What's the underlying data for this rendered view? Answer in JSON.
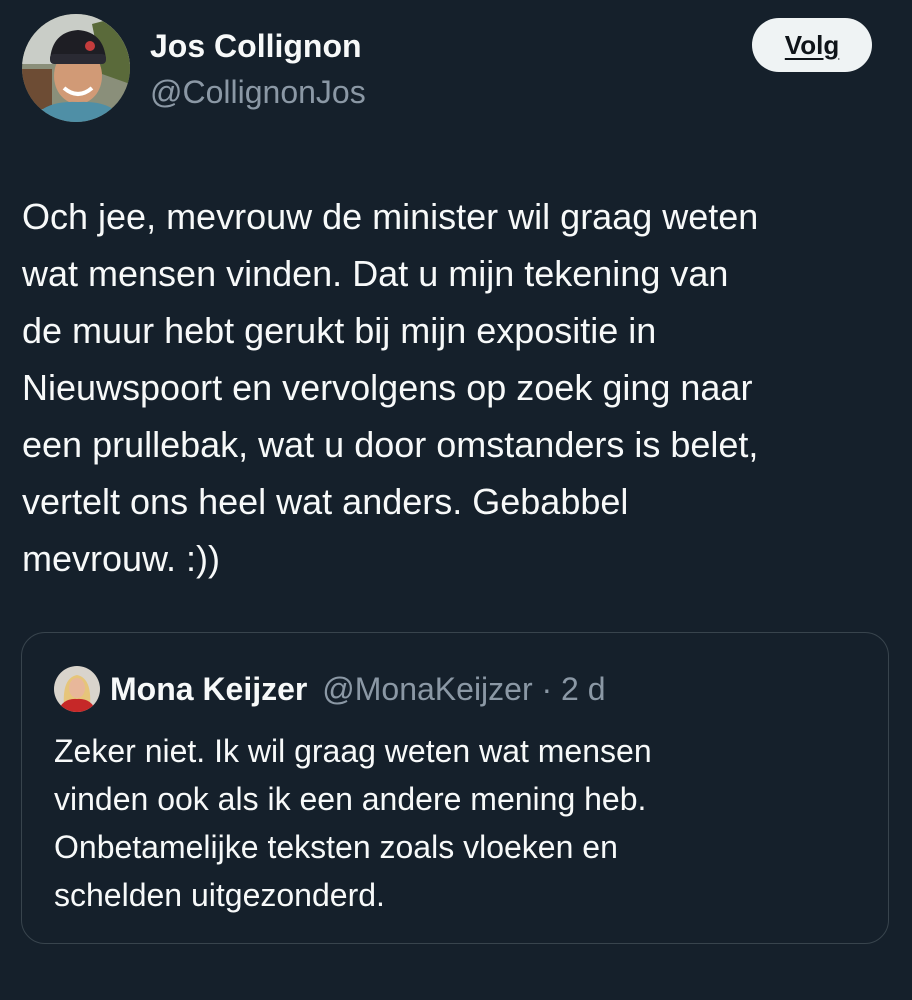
{
  "tweet": {
    "author": {
      "name": "Jos Collignon",
      "handle": "@CollignonJos",
      "avatar_icon": "profile-photo"
    },
    "follow_label": "Volg",
    "text": "Och jee, mevrouw de minister wil graag weten\nwat mensen vinden. Dat u mijn tekening van\nde muur hebt gerukt bij mijn expositie in\nNieuwspoort en vervolgens op zoek ging naar\neen prullebak, wat u door omstanders is belet,\nvertelt ons heel wat anders. Gebabbel\nmevrouw. :))"
  },
  "quote": {
    "author": {
      "name": "Mona Keijzer",
      "handle": "@MonaKeijzer",
      "avatar_icon": "profile-photo"
    },
    "separator": "·",
    "time": "2 d",
    "text": "Zeker niet. Ik wil graag weten wat mensen\nvinden ook als ik een andere mening heb.\nOnbetamelijke teksten zoals vloeken en\nschelden uitgezonderd."
  },
  "colors": {
    "background": "#15202b",
    "primary_text": "#f7f9f9",
    "secondary_text": "#8b98a5",
    "border": "#38444d",
    "button_bg": "#eff3f4",
    "button_text": "#0f1419"
  }
}
